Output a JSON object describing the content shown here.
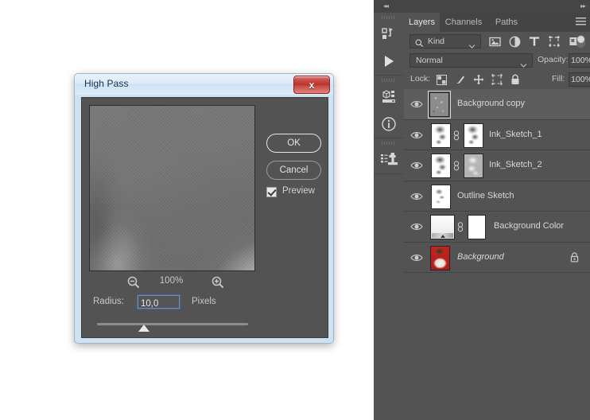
{
  "dialog": {
    "title": "High Pass",
    "close_label": "x",
    "buttons": {
      "ok": "OK",
      "cancel": "Cancel"
    },
    "preview_checkbox": {
      "label": "Preview",
      "checked": true
    },
    "zoom": {
      "level": "100%",
      "minus_icon": "zoom-out-icon",
      "plus_icon": "zoom-in-icon"
    },
    "radius": {
      "label": "Radius:",
      "value": "10,0",
      "units": "Pixels",
      "placeholder": "10,0"
    }
  },
  "dock": {
    "collapse_left_icon": "collapse-to-icons-icon",
    "collapse_right_icon": "expand-panels-icon",
    "rail": [
      {
        "name": "actions-panel-icon",
        "group": 1
      },
      {
        "name": "play-action-icon",
        "group": 1
      },
      {
        "name": "3d-panel-icon",
        "group": 2
      },
      {
        "name": "info-panel-icon",
        "group": 2
      },
      {
        "name": "clone-source-panel-icon",
        "group": 3
      }
    ]
  },
  "panel": {
    "tabs": [
      {
        "label": "Layers",
        "active": true
      },
      {
        "label": "Channels",
        "active": false
      },
      {
        "label": "Paths",
        "active": false
      }
    ],
    "menu_icon": "panel-menu-icon",
    "filter": {
      "kind_label": "Kind",
      "search_icon": "search-icon",
      "chevron_icon": "chevron-down-icon",
      "type_filters": [
        {
          "name": "filter-pixel-layers-icon",
          "glyph": "image"
        },
        {
          "name": "filter-adjustment-layers-icon",
          "glyph": "halfcircle"
        },
        {
          "name": "filter-type-layers-icon",
          "glyph": "T"
        },
        {
          "name": "filter-shape-layers-icon",
          "glyph": "shape"
        },
        {
          "name": "filter-smart-object-layers-icon",
          "glyph": "smart"
        }
      ],
      "toggle_icon": "filter-enable-toggle"
    },
    "blend": {
      "mode": "Normal",
      "opacity_label": "Opacity:",
      "opacity_value": "100%",
      "chevron_icon": "chevron-down-icon"
    },
    "lock": {
      "label": "Lock:",
      "buttons": [
        {
          "name": "lock-transparent-pixels-icon"
        },
        {
          "name": "lock-image-pixels-icon"
        },
        {
          "name": "lock-position-icon"
        },
        {
          "name": "lock-artboard-nesting-icon"
        },
        {
          "name": "lock-all-icon"
        }
      ],
      "fill_label": "Fill:",
      "fill_value": "100%"
    },
    "layers": [
      {
        "name": "Background copy",
        "selected": true,
        "visible": true,
        "thumb": "grey-noise",
        "has_mask": false,
        "locked": false,
        "italic": false
      },
      {
        "name": "Ink_Sketch_1",
        "selected": false,
        "visible": true,
        "thumb": "checker-ink",
        "has_mask": true,
        "mask": "ink",
        "locked": false,
        "italic": false
      },
      {
        "name": "Ink_Sketch_2",
        "selected": false,
        "visible": true,
        "thumb": "checker-ink",
        "has_mask": true,
        "mask": "inkgrey",
        "locked": false,
        "italic": false
      },
      {
        "name": "Outline Sketch",
        "selected": false,
        "visible": true,
        "thumb": "outline",
        "has_mask": false,
        "locked": false,
        "italic": false
      },
      {
        "name": "Background Color",
        "selected": false,
        "visible": true,
        "thumb": "gradient-fill",
        "has_mask": true,
        "mask": "white",
        "locked": false,
        "italic": false
      },
      {
        "name": "Background",
        "selected": false,
        "visible": true,
        "thumb": "portrait",
        "has_mask": false,
        "locked": true,
        "italic": true
      }
    ]
  }
}
